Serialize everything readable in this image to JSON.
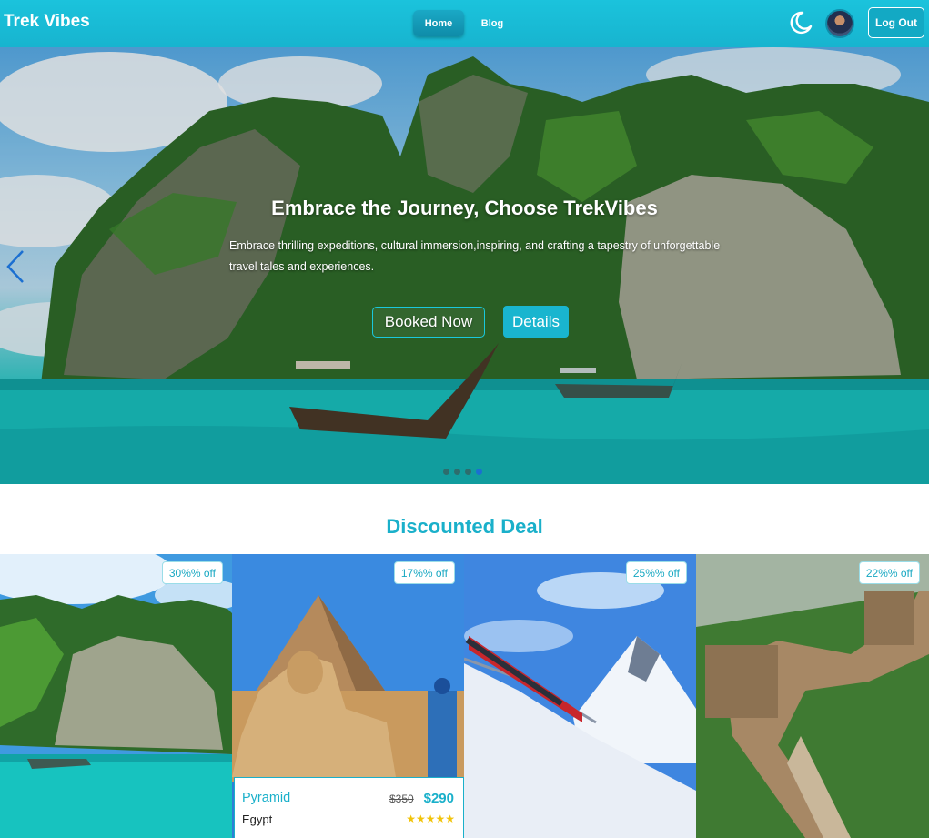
{
  "navbar": {
    "brand": "Trek Vibes",
    "home_label": "Home",
    "blog_label": "Blog",
    "logout_label": "Log Out"
  },
  "hero": {
    "title": "Embrace the Journey, Choose TrekVibes",
    "subtitle": "Embrace thrilling expeditions, cultural immersion,inspiring, and crafting a tapestry of unforgettable travel tales and experiences.",
    "book_label": "Booked Now",
    "details_label": "Details",
    "slide_count": 4,
    "active_slide": 4
  },
  "deals": {
    "title": "Discounted Deal",
    "cards": [
      {
        "badge": "30%% off"
      },
      {
        "badge": "17%% off",
        "name": "Pyramid",
        "old_price": "$350",
        "new_price": "$290",
        "country": "Egypt",
        "stars": "★★★★★"
      },
      {
        "badge": "25%% off"
      },
      {
        "badge": "22%% off"
      }
    ]
  }
}
